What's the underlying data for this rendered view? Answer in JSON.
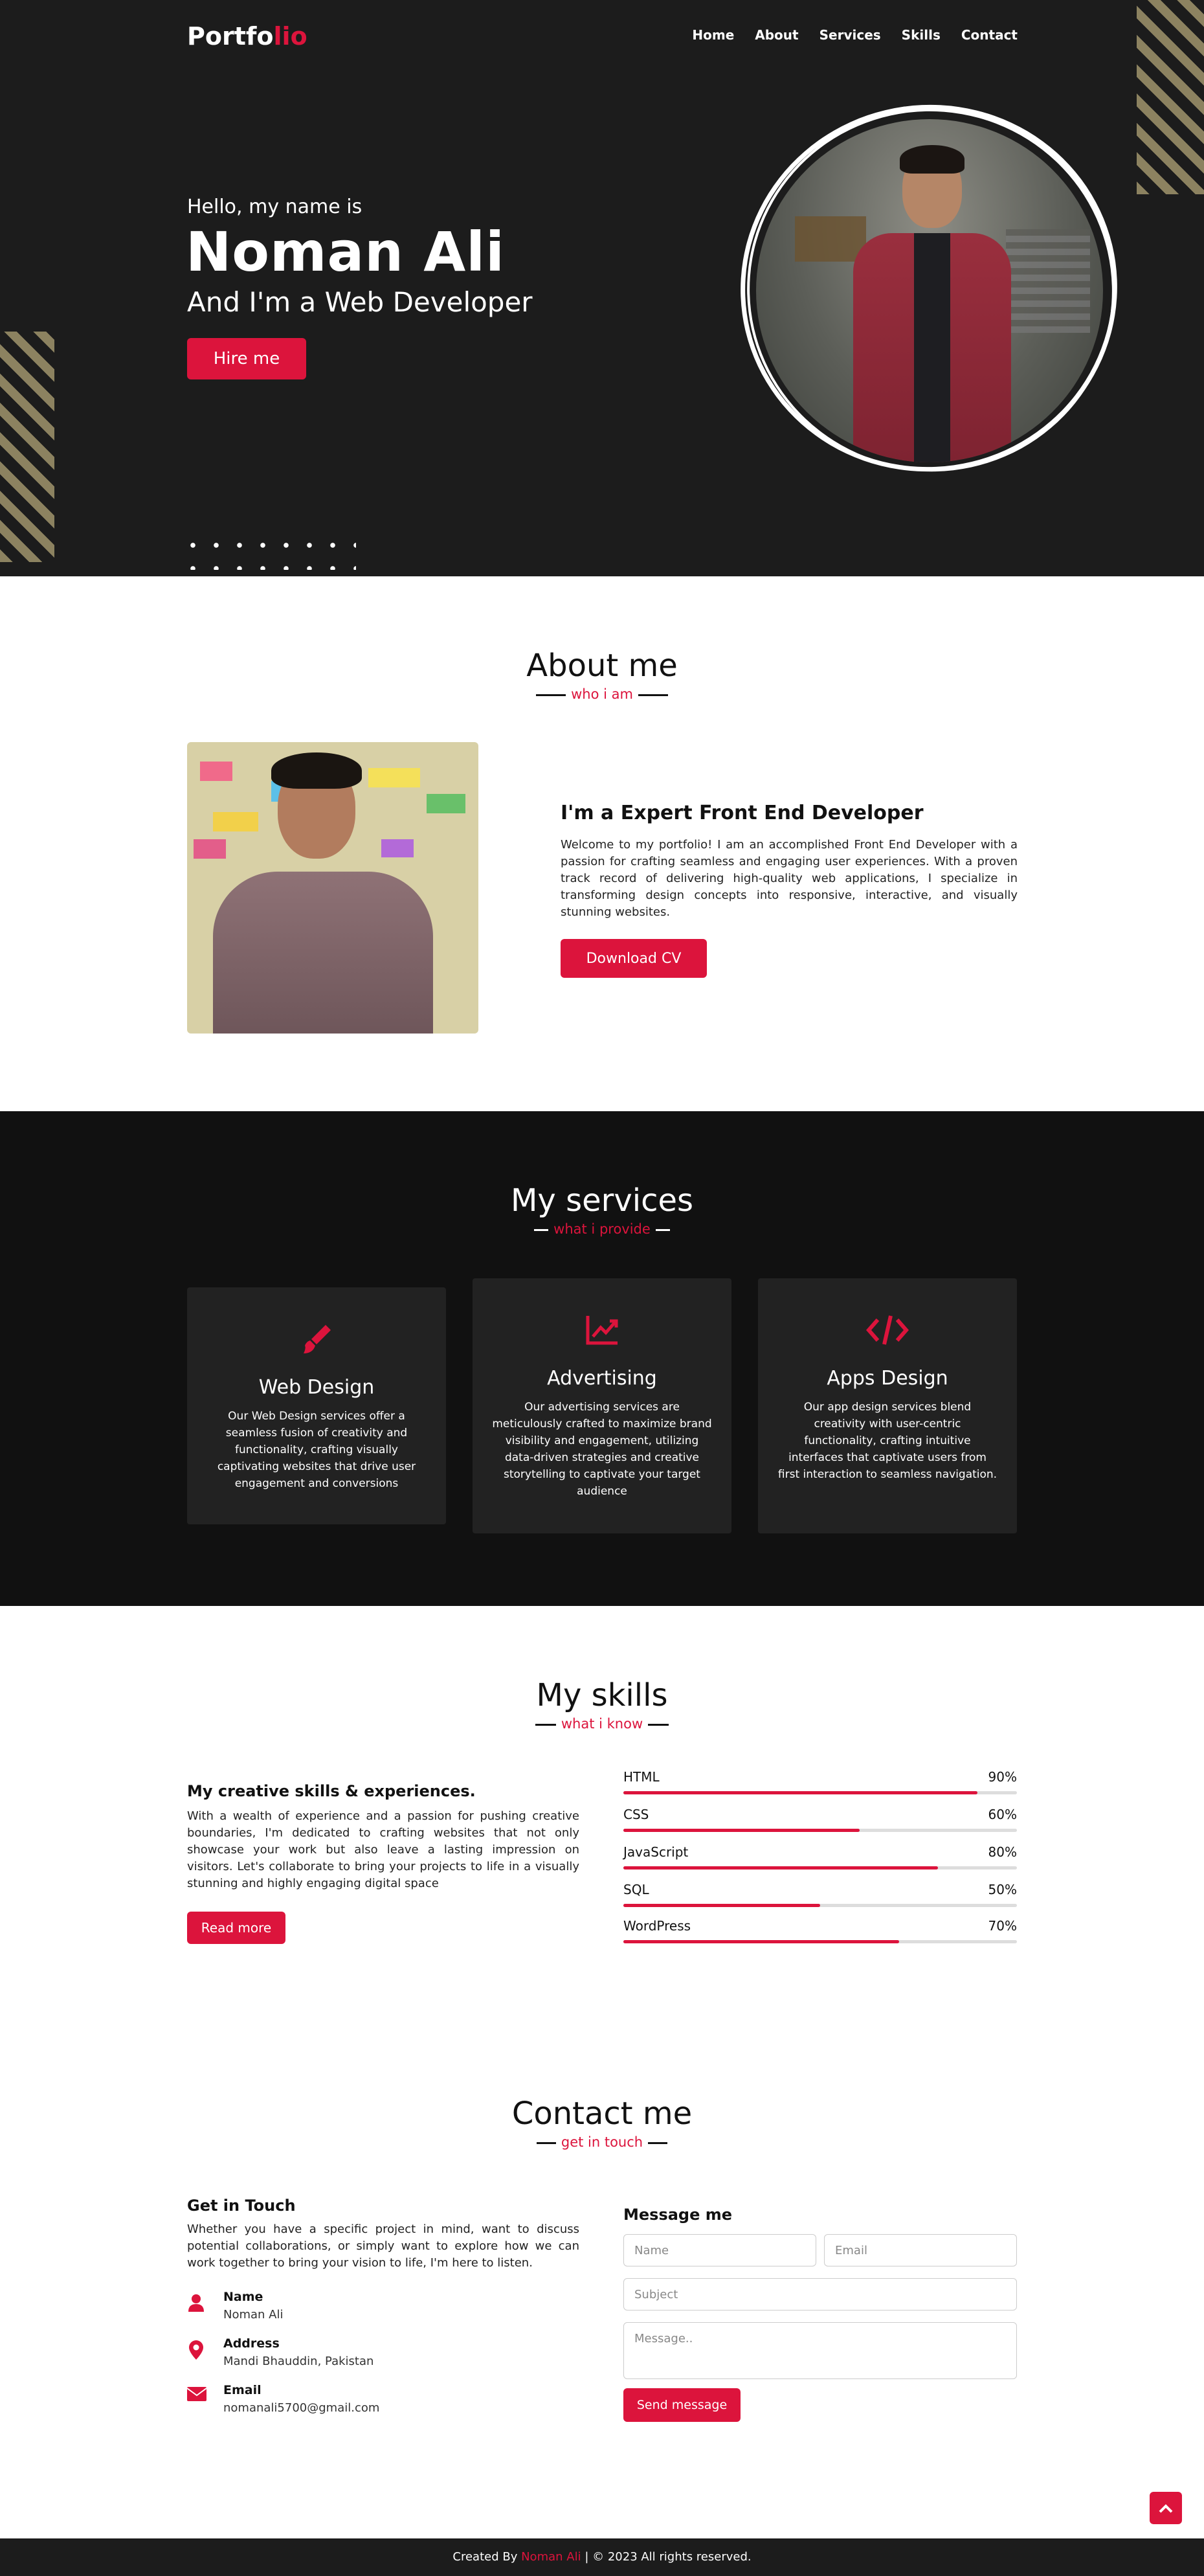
{
  "brand": {
    "logo_main": "Portfo",
    "logo_accent": "lio"
  },
  "nav": {
    "items": [
      "Home",
      "About",
      "Services",
      "Skills",
      "Contact"
    ]
  },
  "hero": {
    "greeting": "Hello, my name is",
    "name": "Noman Ali",
    "role": "And I'm a Web Developer",
    "cta": "Hire me"
  },
  "about": {
    "title": "About me",
    "subtitle": "who i am",
    "heading": "I'm a Expert Front End Developer",
    "text": "Welcome to my portfolio! I am an accomplished Front End Developer with a passion for crafting seamless and engaging user experiences. With a proven track record of delivering high-quality web applications, I specialize in transforming design concepts into responsive, interactive, and visually stunning websites.",
    "cta": "Download CV"
  },
  "services": {
    "title": "My services",
    "subtitle": "what i provide",
    "cards": [
      {
        "icon": "paintbrush-icon",
        "title": "Web Design",
        "text": "Our Web Design services offer a seamless fusion of creativity and functionality, crafting visually captivating websites that drive user engagement and conversions"
      },
      {
        "icon": "chart-line-icon",
        "title": "Advertising",
        "text": "Our advertising services are meticulously crafted to maximize brand visibility and engagement, utilizing data-driven strategies and creative storytelling to captivate your target audience"
      },
      {
        "icon": "code-icon",
        "title": "Apps Design",
        "text": "Our app design services blend creativity with user-centric functionality, crafting intuitive interfaces that captivate users from first interaction to seamless navigation."
      }
    ]
  },
  "skills": {
    "title": "My skills",
    "subtitle": "what i know",
    "heading": "My creative skills & experiences.",
    "text": "With a wealth of experience and a passion for pushing creative boundaries, I'm dedicated to crafting websites that not only showcase your work but also leave a lasting impression on visitors. Let's collaborate to bring your projects to life in a visually stunning and highly engaging digital space",
    "cta": "Read more",
    "list": [
      {
        "name": "HTML",
        "percent_label": "90%",
        "level": 0.9
      },
      {
        "name": "CSS",
        "percent_label": "60%",
        "level": 0.6
      },
      {
        "name": "JavaScript",
        "percent_label": "80%",
        "level": 0.8
      },
      {
        "name": "SQL",
        "percent_label": "50%",
        "level": 0.5
      },
      {
        "name": "WordPress",
        "percent_label": "70%",
        "level": 0.7
      }
    ]
  },
  "contact": {
    "title": "Contact me",
    "subtitle": "get in touch",
    "heading": "Get in Touch",
    "text": "Whether you have a specific project in mind, want to discuss potential collaborations, or simply want to explore how we can work together to bring your vision to life, I'm here to listen.",
    "items": [
      {
        "icon": "user-icon",
        "label": "Name",
        "value": "Noman Ali"
      },
      {
        "icon": "map-marker-icon",
        "label": "Address",
        "value": "Mandi Bhauddin, Pakistan"
      },
      {
        "icon": "envelope-icon",
        "label": "Email",
        "value": "nomanali5700@gmail.com"
      }
    ],
    "form": {
      "heading": "Message me",
      "name_placeholder": "Name",
      "email_placeholder": "Email",
      "subject_placeholder": "Subject",
      "message_placeholder": "Message..",
      "submit": "Send message"
    }
  },
  "footer": {
    "prefix": "Created By",
    "author": "Noman Ali",
    "suffix": "| © 2023 All rights reserved."
  },
  "colors": {
    "accent": "#dc143c",
    "dark": "#1c1c1c",
    "card": "#222222"
  }
}
